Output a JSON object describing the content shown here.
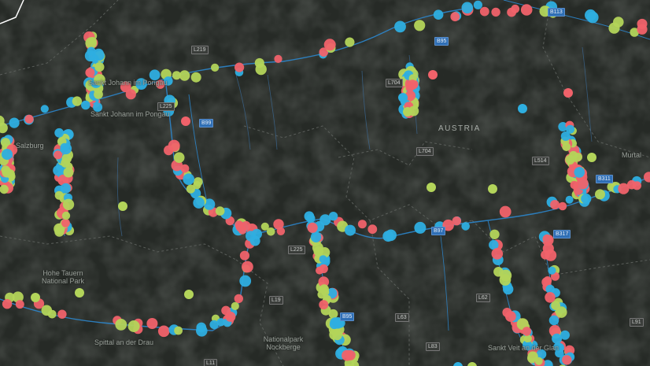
{
  "map": {
    "country": "AUSTRIA",
    "places": [
      "Sankt Johann im Pongau",
      "Salzburg",
      "Hohe Tauern National Park",
      "Spittal an der Drau",
      "Nationalpark Nockberge",
      "Sankt Veit an der Glan",
      "Murtal"
    ],
    "routes": [
      "B113",
      "L219",
      "L704",
      "B99",
      "L225",
      "L19",
      "B95",
      "L63",
      "L62",
      "L11",
      "L514",
      "B317",
      "B311",
      "L91",
      "L83",
      "B97"
    ],
    "colors": {
      "red": "#f0626a",
      "blue": "#2eaee0",
      "green": "#b3d45a",
      "background": "#232723",
      "river": "#2c86cc"
    }
  }
}
